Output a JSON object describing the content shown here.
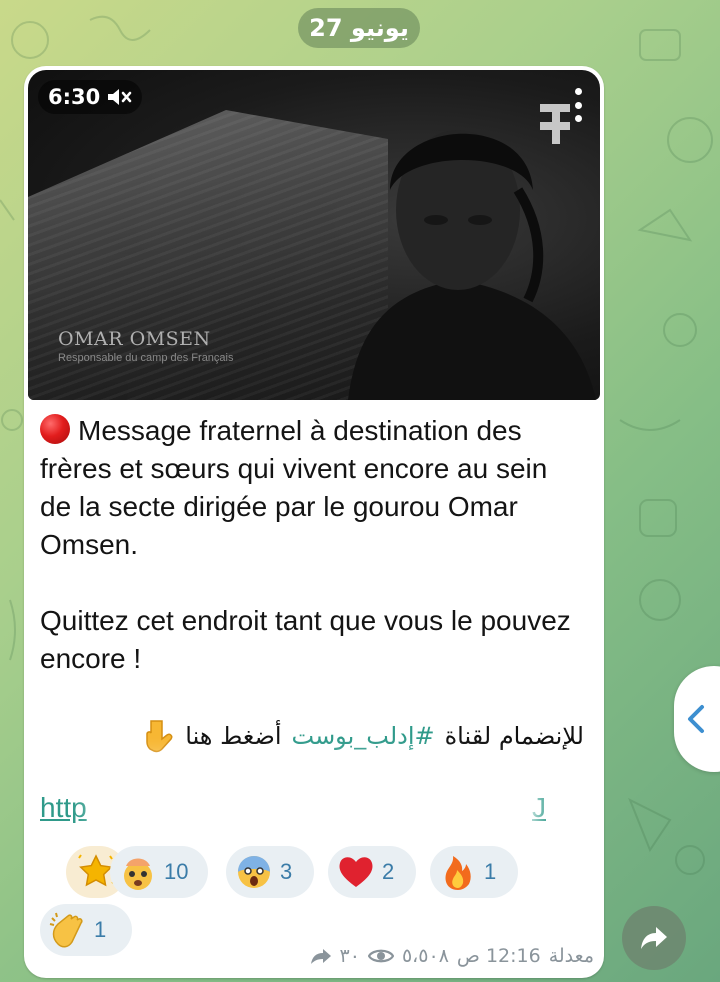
{
  "date_label": "27 يونيو",
  "video": {
    "duration": "6:30",
    "muted": true,
    "overlay_name": "OMAR OMSEN",
    "overlay_subtitle": "Responsable du camp des Français"
  },
  "message": {
    "paragraph1": "Message fraternel à destination des frères et sœurs qui vivent encore au sein de la secte dirigée par le gourou Omar Omsen.",
    "paragraph2": "Quittez cet endroit tant que vous le pouvez encore !",
    "arabic_prefix": "للإنضمام لقناة",
    "hashtag": "#إدلب_بوست",
    "arabic_cta": "أضغط هنا",
    "link_start": "http",
    "link_end": "J"
  },
  "reactions": [
    {
      "emoji": "exploding-head",
      "count": "10"
    },
    {
      "emoji": "screaming-face",
      "count": "3"
    },
    {
      "emoji": "red-heart",
      "count": "2"
    },
    {
      "emoji": "fire",
      "count": "1"
    },
    {
      "emoji": "clapping-hands",
      "count": "1"
    }
  ],
  "meta": {
    "edited_label": "معدلة",
    "time": "12:16 ص",
    "views": "٥،٥٠٨",
    "shares": "٣٠"
  },
  "colors": {
    "link": "#2f9a8a",
    "reaction_bg": "#e9eff3",
    "reaction_text": "#3b7ca8",
    "meta_text": "#8a949b"
  }
}
